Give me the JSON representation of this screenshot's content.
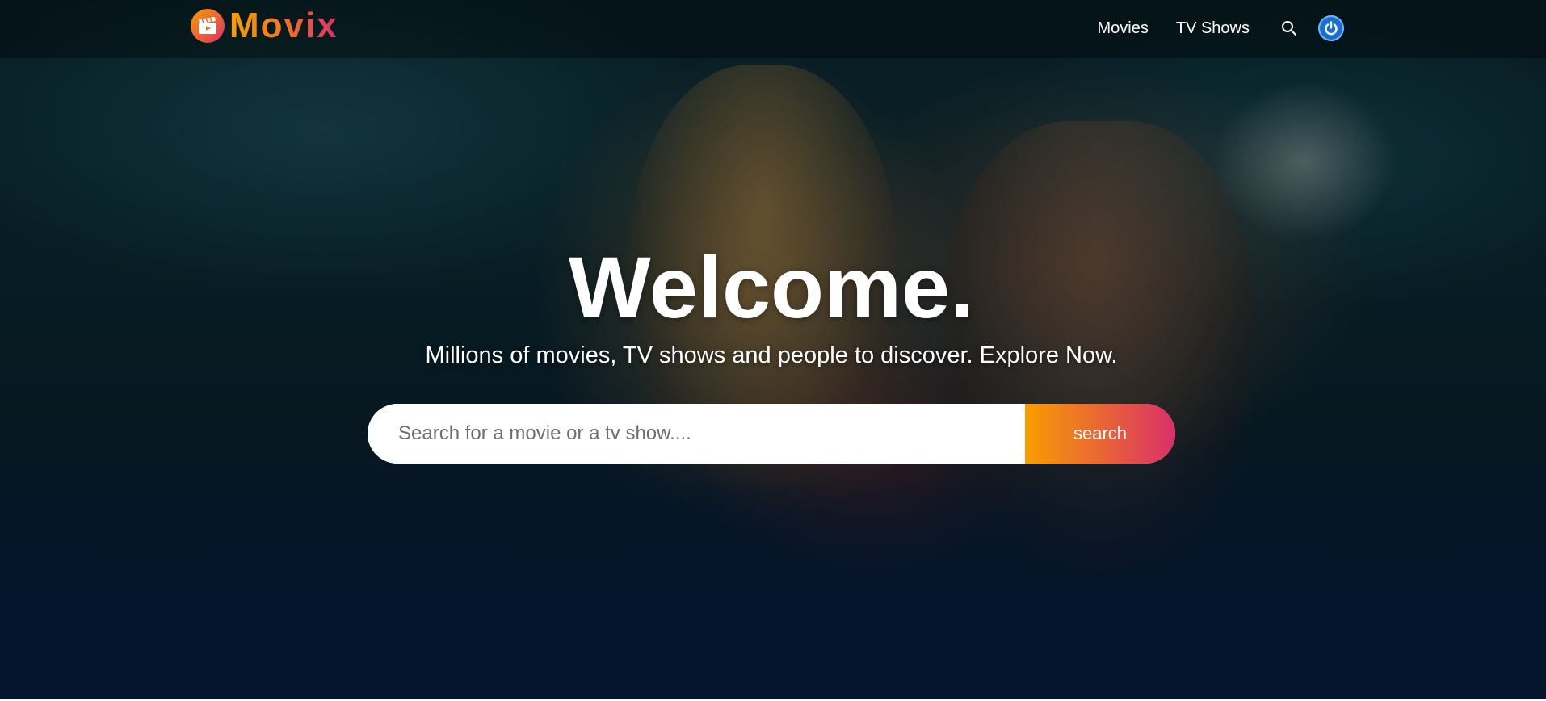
{
  "brand": {
    "name": "Movix",
    "logo_icon": "clapperboard-icon",
    "gradient_start": "#f89e00",
    "gradient_end": "#da2f68"
  },
  "nav": {
    "items": [
      {
        "label": "Movies"
      },
      {
        "label": "TV Shows"
      }
    ],
    "search_icon": "search-icon",
    "account_icon": "power-icon"
  },
  "hero": {
    "title": "Welcome.",
    "subtitle": "Millions of movies, TV shows and people to discover. Explore Now.",
    "search": {
      "placeholder": "Search for a movie or a tv show....",
      "value": "",
      "button_label": "search"
    }
  },
  "colors": {
    "background": "#04152d",
    "text": "#ffffff"
  }
}
